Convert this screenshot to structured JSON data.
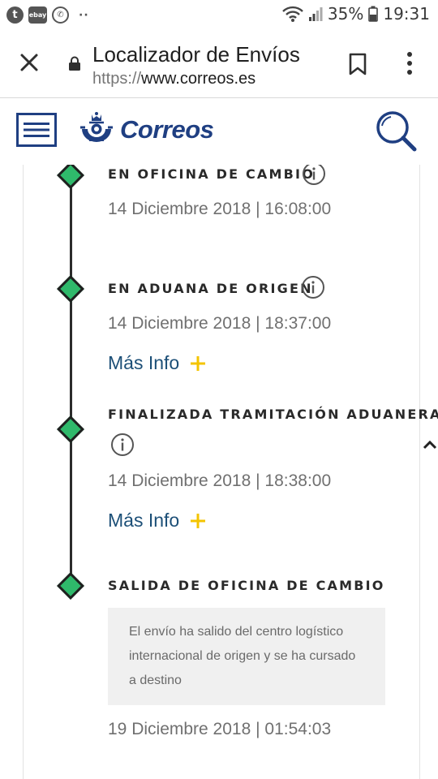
{
  "status_bar": {
    "notification_icons": [
      "tumblr-icon",
      "ebay-icon",
      "whatsapp-icon"
    ],
    "ebay_label": "ebay",
    "overflow": "··",
    "battery": "35%",
    "time": "19:31"
  },
  "browser": {
    "page_title": "Localizador de Envíos",
    "url_scheme": "https://",
    "url_host": "www.correos.es"
  },
  "site_header": {
    "logo_text": "Correos",
    "brand_color": "#1f3f82",
    "accent_color": "#f4c400"
  },
  "timeline": {
    "node_color": "#2fb96b",
    "events": [
      {
        "title": "EN OFICINA DE CAMBIO",
        "date": "14 Diciembre 2018 | 16:08:00"
      },
      {
        "title": "EN ADUANA DE ORIGEN",
        "date": "14 Diciembre 2018 | 18:37:00",
        "more_info": "Más Info"
      },
      {
        "title": "FINALIZADA TRAMITACIÓN ADUANERA",
        "date": "14 Diciembre 2018 | 18:38:00",
        "more_info": "Más Info"
      },
      {
        "title": "SALIDA DE OFICINA DE CAMBIO",
        "description": "El envío ha salido del centro logístico internacional de origen y se ha cursado a destino",
        "date": "19 Diciembre 2018 | 01:54:03"
      }
    ]
  }
}
